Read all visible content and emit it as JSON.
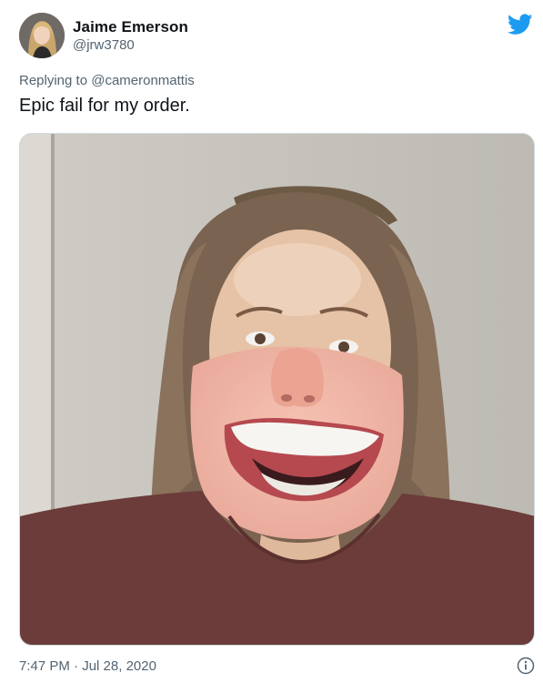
{
  "author": {
    "name": "Jaime Emerson",
    "handle": "@jrw3780"
  },
  "reply": {
    "prefix": "Replying to ",
    "mention": "@cameronmattis"
  },
  "tweet": {
    "text": "Epic fail for my order."
  },
  "meta": {
    "time": "7:47 PM",
    "separator": " · ",
    "date": "Jul 28, 2020"
  },
  "icons": {
    "logo": "twitter-bird-icon",
    "info": "info-icon"
  },
  "colors": {
    "brand": "#1d9bf0",
    "text_primary": "#0f1419",
    "text_secondary": "#536471"
  }
}
